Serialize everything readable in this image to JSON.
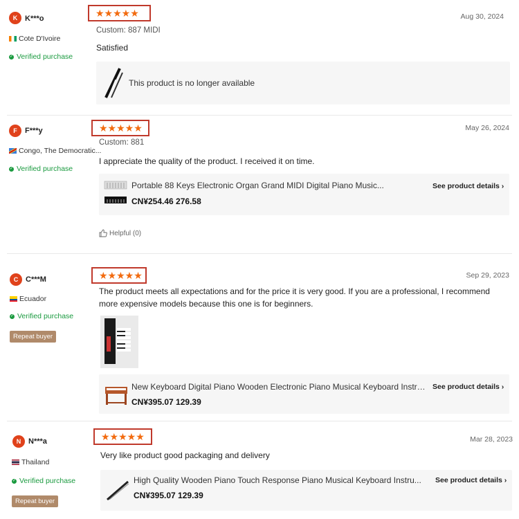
{
  "reviews": [
    {
      "avatar_letter": "K",
      "username": "K***o",
      "country": "Cote D'Ivoire",
      "verified": "Verified purchase",
      "stars": "★★★★★",
      "rating": 5,
      "date": "Aug 30, 2024",
      "custom_label": "Custom:",
      "custom_value": "887 MIDI",
      "text": "Satisfied",
      "product_title": "This product is no longer available"
    },
    {
      "avatar_letter": "F",
      "username": "F***y",
      "country": "Congo, The Democratic...",
      "verified": "Verified purchase",
      "stars": "★★★★★",
      "rating": 5,
      "date": "May 26, 2024",
      "custom_label": "Custom:",
      "custom_value": "881",
      "text": "I appreciate the quality of the product. I received it on time.",
      "product_title": "Portable 88 Keys Electronic Organ Grand MIDI Digital Piano Music...",
      "product_price": "CN¥254.46 276.58",
      "see_details": "See product details",
      "helpful": "Helpful (0)"
    },
    {
      "avatar_letter": "C",
      "username": "C***M",
      "country": "Ecuador",
      "verified": "Verified purchase",
      "repeat": "Repeat buyer",
      "stars": "★★★★★",
      "rating": 5,
      "date": "Sep 29, 2023",
      "text": "The product meets all expectations and for the price it is very good. If you are a professional, I recommend more expensive models because this one is for beginners.",
      "product_title": "New Keyboard Digital Piano Wooden Electronic Piano Musical Keyboard Instrument wit...",
      "product_price": "CN¥395.07 129.39",
      "see_details": "See product details"
    },
    {
      "avatar_letter": "N",
      "username": "N***a",
      "country": "Thailand",
      "verified": "Verified purchase",
      "repeat": "Repeat buyer",
      "stars": "★★★★★",
      "rating": 5,
      "date": "Mar 28, 2023",
      "text": "Very like product good packaging and delivery",
      "product_title": "High Quality Wooden Piano Touch Response Piano Musical Keyboard Instru...",
      "product_price": "CN¥395.07 129.39",
      "see_details": "See product details"
    }
  ],
  "colors": {
    "star": "#f26b0f",
    "highlight_box": "#c0392b",
    "verified": "#1a9a3f",
    "avatar": "#e0421b",
    "repeat_badge": "#b08a6a"
  }
}
